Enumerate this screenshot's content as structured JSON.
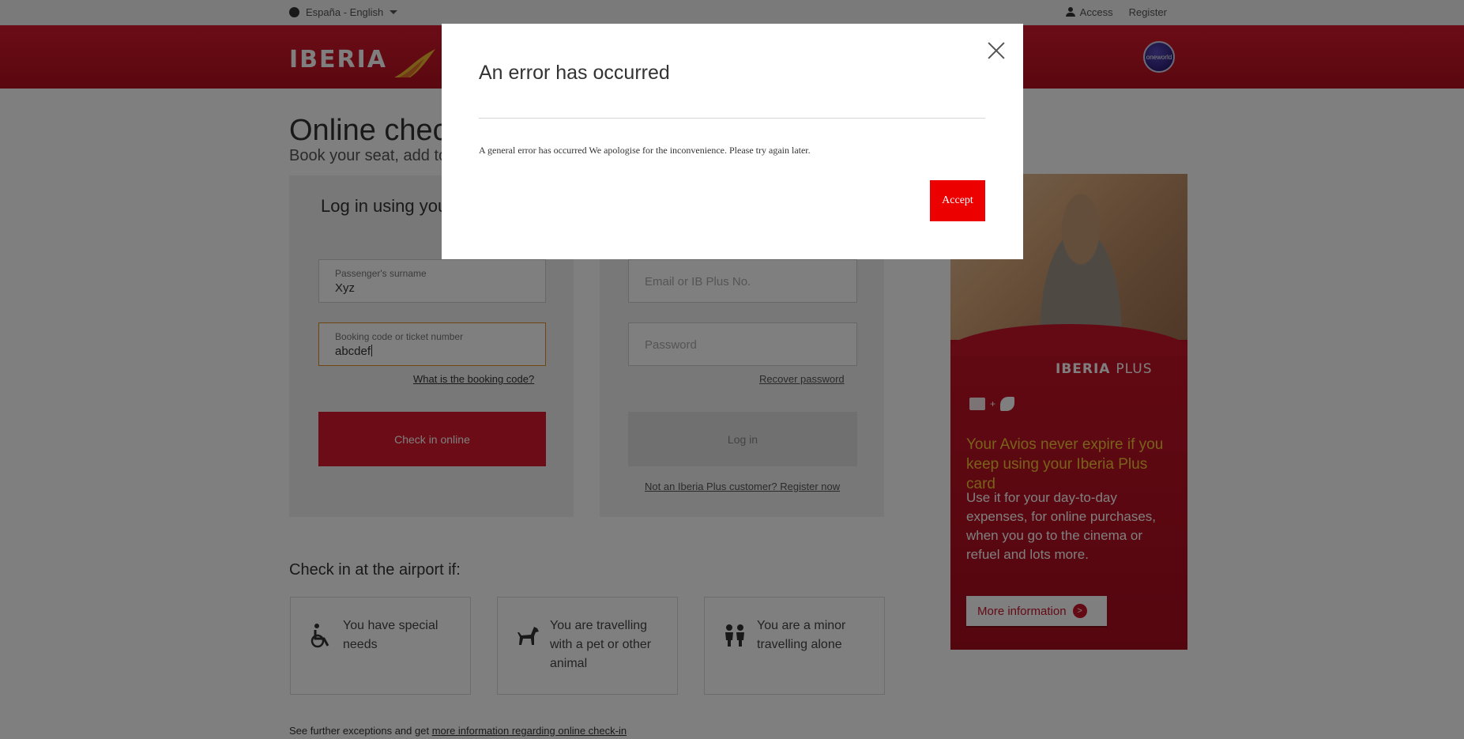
{
  "topbar": {
    "language": "España - English",
    "access": "Access",
    "register": "Register"
  },
  "header": {
    "logo_text": "IBERIA",
    "oneworld": "oneworld"
  },
  "page": {
    "title": "Online check-in",
    "subtitle": "Book your seat, add to"
  },
  "left_panel": {
    "heading": "Log in using you",
    "surname_label": "Passenger's surname",
    "surname_value": "Xyz",
    "booking_label": "Booking code or ticket number",
    "booking_value": "abcdef",
    "booking_help_link": "What is the booking code?",
    "checkin_button": "Check in online"
  },
  "right_panel": {
    "email_placeholder": "Email or IB Plus No.",
    "password_placeholder": "Password",
    "recover_link": "Recover password",
    "login_button": "Log in",
    "register_link": "Not an Iberia Plus customer? Register now"
  },
  "airport": {
    "title": "Check in at the airport if:",
    "cards": [
      {
        "icon": "wheelchair-icon",
        "text": "You have special needs"
      },
      {
        "icon": "dog-icon",
        "text": "You are travelling with a pet or other animal"
      },
      {
        "icon": "children-icon",
        "text": "You are a minor travelling alone"
      }
    ]
  },
  "footnote": {
    "prefix": "See further exceptions and get",
    "link": "more information regarding online check-in"
  },
  "promo": {
    "brand": "IBERIA",
    "brand_plus": "PLUS",
    "headline": "Your Avios never expire if you keep using your Iberia Plus card",
    "body": "Use it for your day-to-day expenses, for online purchases, when you go to the cinema or refuel and lots more.",
    "button": "More information"
  },
  "modal": {
    "title": "An error has occurred",
    "message": "A general error has occurred We apologise for the inconvenience. Please try again later.",
    "accept": "Accept"
  },
  "colors": {
    "brand_red": "#d7192d",
    "accept_red": "#ec0000",
    "promo_yellow": "#f3c437",
    "focus_orange": "#e38a1f"
  }
}
